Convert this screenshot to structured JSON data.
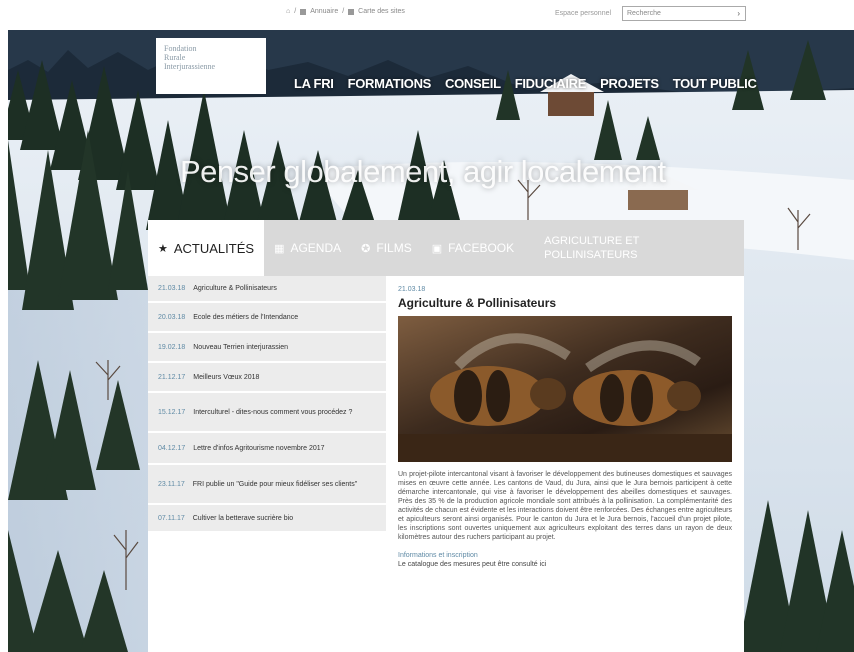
{
  "util": {
    "home_icon": "home-icon",
    "link1": "Annuaire",
    "link2": "Carte des sites"
  },
  "accessibility_label": "Espace personnel",
  "search": {
    "placeholder": "Recherche"
  },
  "logo": {
    "line1": "Fondation",
    "line2": "Rurale",
    "line3": "Interjurassienne"
  },
  "nav": [
    "LA FRI",
    "FORMATIONS",
    "CONSEIL",
    "FIDUCIAIRE",
    "PROJETS",
    "TOUT PUBLIC"
  ],
  "slogan": "Penser globalement, agir localement",
  "tabs": [
    {
      "label": "ACTUALITÉS",
      "icon": "star-icon"
    },
    {
      "label": "AGENDA",
      "icon": "calendar-icon"
    },
    {
      "label": "FILMS",
      "icon": "film-icon"
    },
    {
      "label": "FACEBOOK",
      "icon": "facebook-icon"
    },
    {
      "label": "AGRICULTURE ET POLLINISATEURS",
      "icon": ""
    }
  ],
  "news": [
    {
      "date": "21.03.18",
      "title": "Agriculture & Pollinisateurs"
    },
    {
      "date": "20.03.18",
      "title": "Ecole des métiers de l'Intendance"
    },
    {
      "date": "19.02.18",
      "title": "Nouveau Terrien interjurassien"
    },
    {
      "date": "21.12.17",
      "title": "Meilleurs Vœux 2018"
    },
    {
      "date": "15.12.17",
      "title": "Interculturel - dites-nous comment vous procédez ?"
    },
    {
      "date": "04.12.17",
      "title": "Lettre d'infos Agritourisme novembre 2017"
    },
    {
      "date": "23.11.17",
      "title": "FRI publie un \"Guide pour mieux fidéliser ses clients\""
    },
    {
      "date": "07.11.17",
      "title": "Cultiver la betterave sucrière bio"
    }
  ],
  "article": {
    "date": "21.03.18",
    "title": "Agriculture & Pollinisateurs",
    "image_alt": "bees-image",
    "body": "Un projet-pilote intercantonal visant à favoriser le développement des butineuses domestiques et sauvages mises en œuvre cette année. Les cantons de Vaud, du Jura, ainsi que le Jura bernois participent à cette démarche intercantonale, qui vise à favoriser le développement des abeilles domestiques et sauvages. Près des 35 % de la production agricole mondiale sont attribués à la pollinisation. La complémentarité des activités de chacun est évidente et les interactions doivent être renforcées. Des échanges entre agriculteurs et apiculteurs seront ainsi organisés. Pour le canton du Jura et le Jura bernois, l'accueil d'un projet pilote, les inscriptions sont ouvertes uniquement aux agriculteurs exploitant des terres dans un rayon de deux kilomètres autour des ruchers participant au projet.",
    "more_heading": "Informations et inscription",
    "more_text": "Le catalogue des mesures peut être consulté ici"
  }
}
